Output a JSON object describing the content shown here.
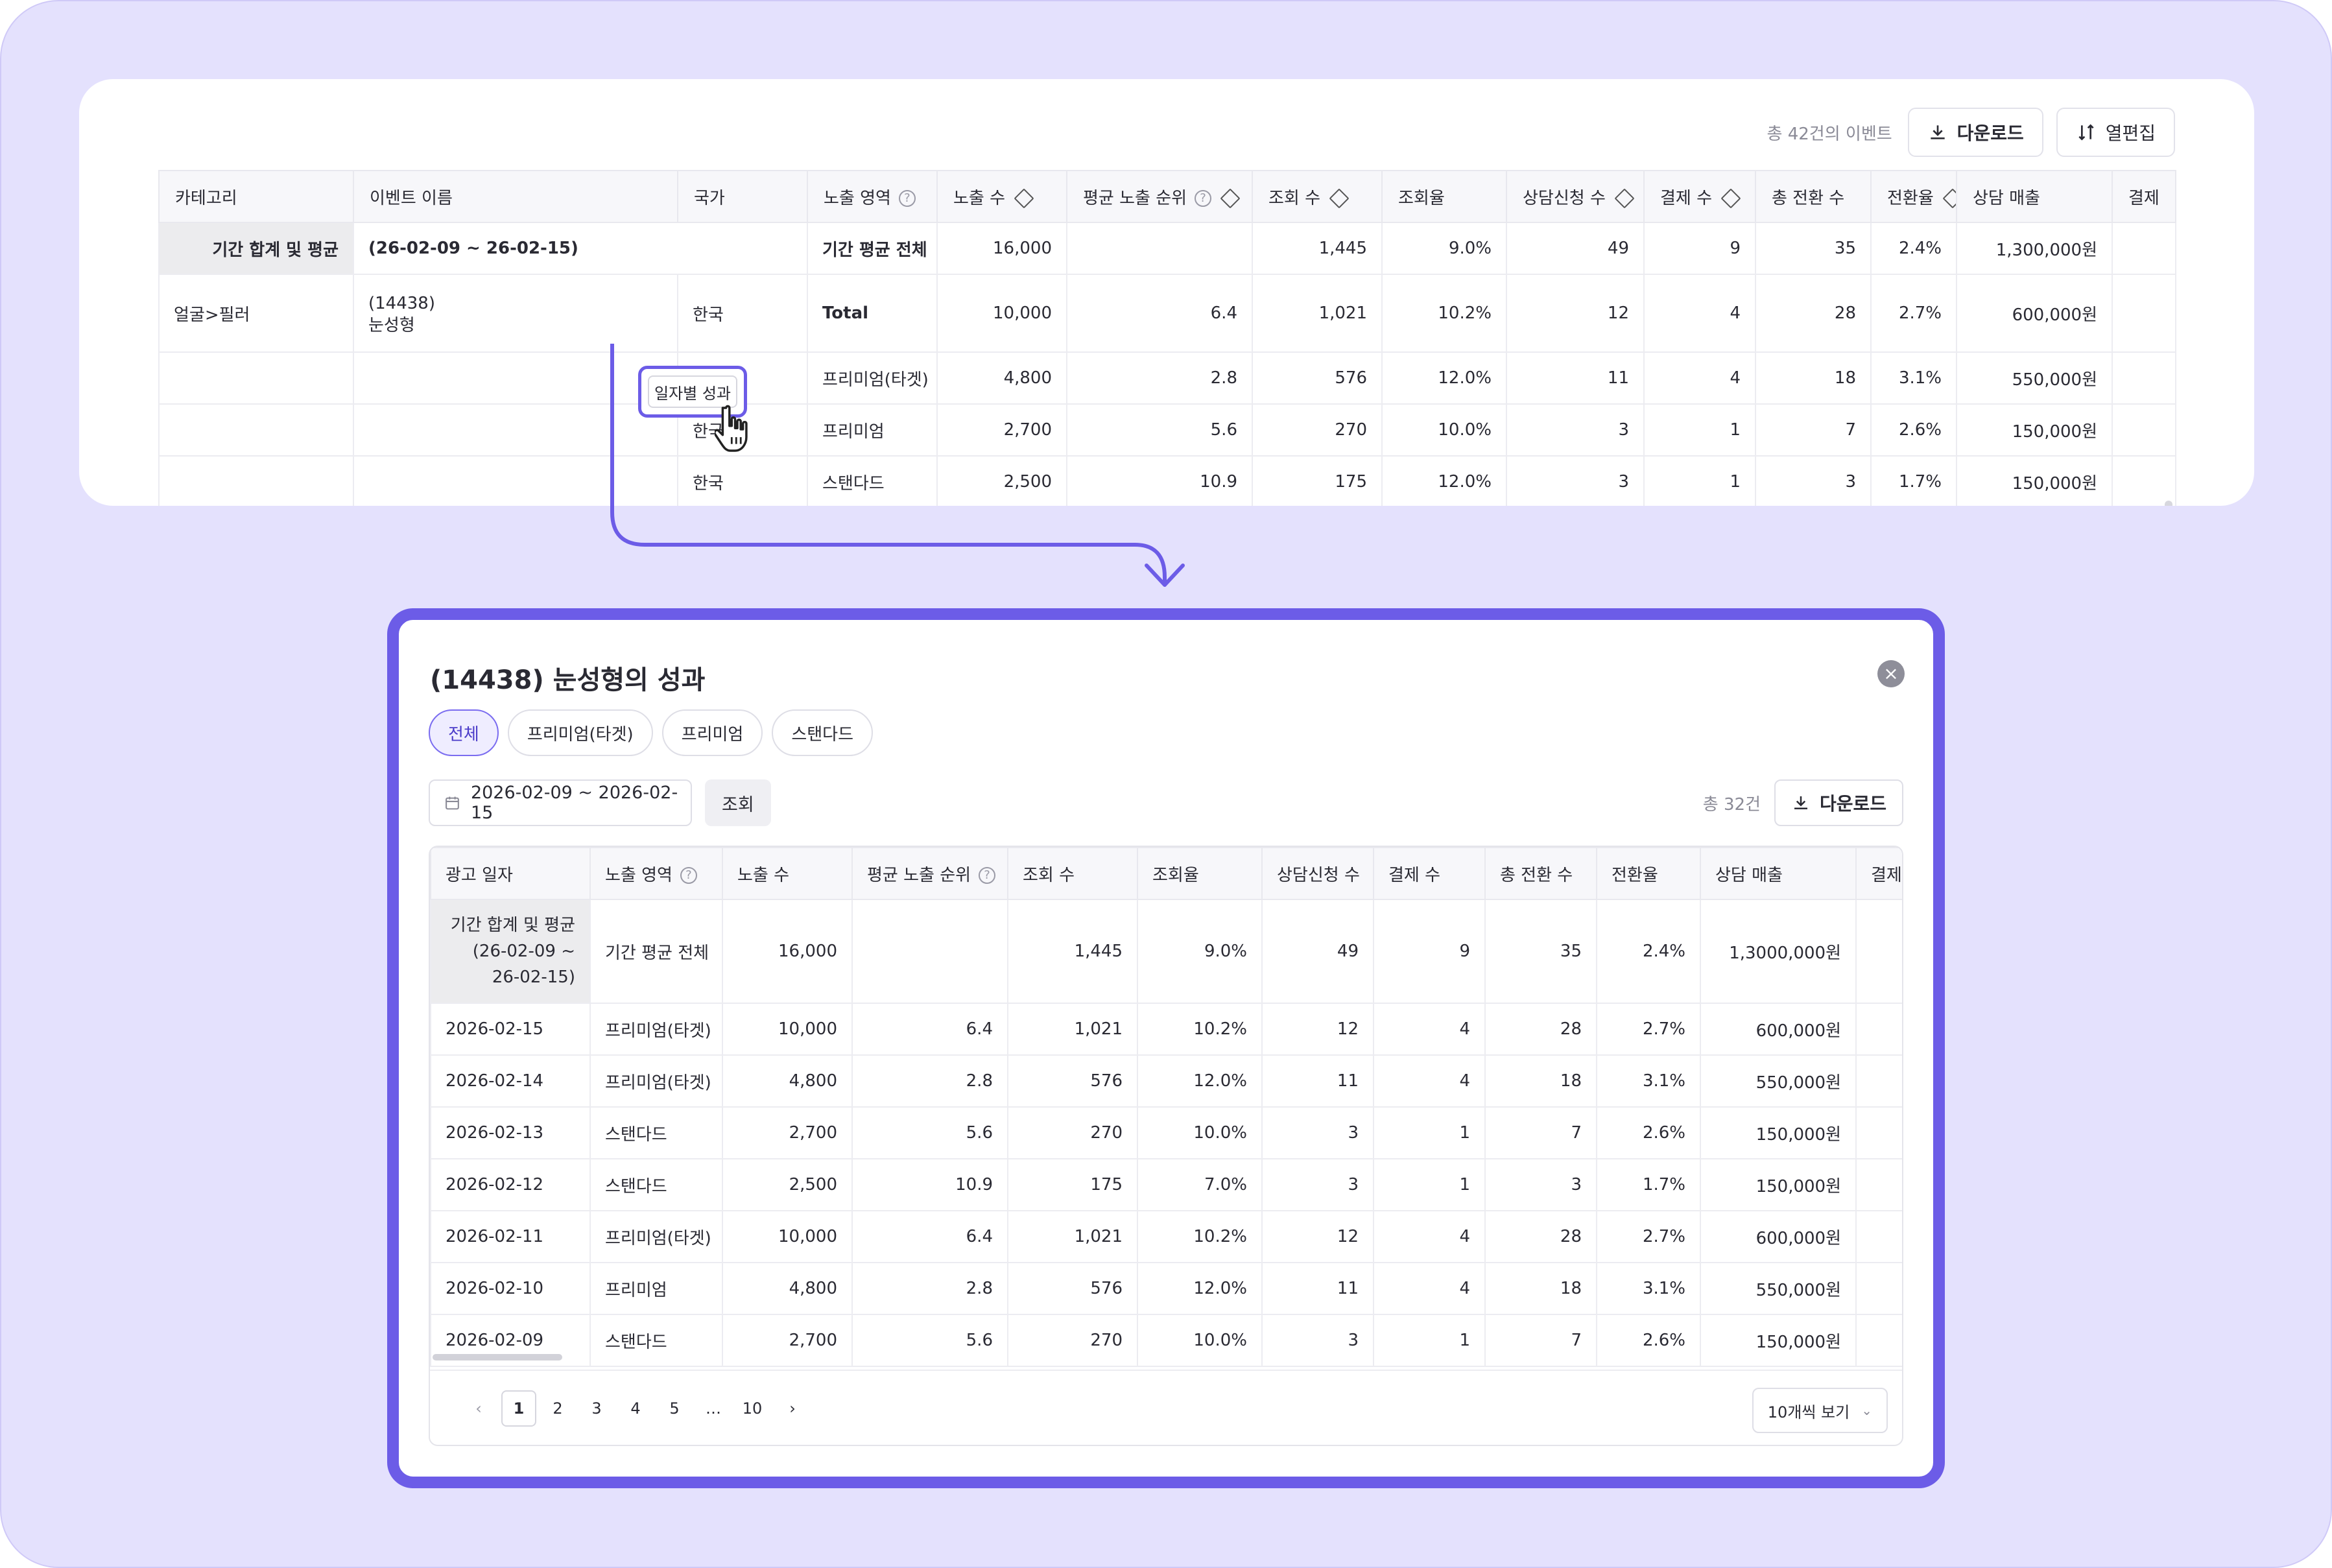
{
  "colors": {
    "accent": "#6c5ce7",
    "background": "#e4e1fd"
  },
  "top": {
    "count_text": "총 42건의 이벤트",
    "download_label": "다운로드",
    "columns_label": "열편집",
    "headers": [
      "카테고리",
      "이벤트 이름",
      "국가",
      "노출 영역",
      "노출 수",
      "평균 노출 순위",
      "조회 수",
      "조회율",
      "상담신청 수",
      "결제 수",
      "총 전환 수",
      "전환율",
      "상담 매출",
      "결제"
    ],
    "summary": {
      "label": "기간 합계 및 평균",
      "range": "(26-02-09 ~ 26-02-15)",
      "area": "기간 평균 전체",
      "impressions": "16,000",
      "rank": "",
      "views": "1,445",
      "view_rate": "9.0%",
      "consults": "49",
      "payments": "9",
      "conversions": "35",
      "conv_rate": "2.4%",
      "revenue": "1,300,000원"
    },
    "event": {
      "category": "얼굴>필러",
      "id": "(14438)",
      "name": "눈성형",
      "daily_button": "일자별 성과"
    },
    "rows": [
      {
        "country": "한국",
        "area": "Total",
        "impressions": "10,000",
        "rank": "6.4",
        "views": "1,021",
        "view_rate": "10.2%",
        "consults": "12",
        "payments": "4",
        "conversions": "28",
        "conv_rate": "2.7%",
        "revenue": "600,000원"
      },
      {
        "country": "한국",
        "area": "프리미엄(타겟)",
        "impressions": "4,800",
        "rank": "2.8",
        "views": "576",
        "view_rate": "12.0%",
        "consults": "11",
        "payments": "4",
        "conversions": "18",
        "conv_rate": "3.1%",
        "revenue": "550,000원"
      },
      {
        "country": "한국",
        "area": "프리미엄",
        "impressions": "2,700",
        "rank": "5.6",
        "views": "270",
        "view_rate": "10.0%",
        "consults": "3",
        "payments": "1",
        "conversions": "7",
        "conv_rate": "2.6%",
        "revenue": "150,000원"
      },
      {
        "country": "한국",
        "area": "스탠다드",
        "impressions": "2,500",
        "rank": "10.9",
        "views": "175",
        "view_rate": "12.0%",
        "consults": "3",
        "payments": "1",
        "conversions": "3",
        "conv_rate": "1.7%",
        "revenue": "150,000원"
      }
    ]
  },
  "modal": {
    "title": "(14438) 눈성형의 성과",
    "tabs": [
      "전체",
      "프리미엄(타겟)",
      "프리미엄",
      "스탠다드"
    ],
    "active_tab": "전체",
    "date_range": "2026-02-09 ~ 2026-02-15",
    "query_label": "조회",
    "count_text": "총 32건",
    "download_label": "다운로드",
    "headers": [
      "광고 일자",
      "노출 영역",
      "노출 수",
      "평균 노출 순위",
      "조회 수",
      "조회율",
      "상담신청 수",
      "결제 수",
      "총 전환 수",
      "전환율",
      "상담 매출",
      "결제"
    ],
    "summary": {
      "label": "기간 합계 및 평균 (26-02-09 ~ 26-02-15)",
      "area": "기간 평균 전체",
      "impressions": "16,000",
      "rank": "",
      "views": "1,445",
      "view_rate": "9.0%",
      "consults": "49",
      "payments": "9",
      "conversions": "35",
      "conv_rate": "2.4%",
      "revenue": "1,3000,000원"
    },
    "rows": [
      {
        "date": "2026-02-15",
        "area": "프리미엄(타겟)",
        "impressions": "10,000",
        "rank": "6.4",
        "views": "1,021",
        "view_rate": "10.2%",
        "consults": "12",
        "payments": "4",
        "conversions": "28",
        "conv_rate": "2.7%",
        "revenue": "600,000원"
      },
      {
        "date": "2026-02-14",
        "area": "프리미엄(타겟)",
        "impressions": "4,800",
        "rank": "2.8",
        "views": "576",
        "view_rate": "12.0%",
        "consults": "11",
        "payments": "4",
        "conversions": "18",
        "conv_rate": "3.1%",
        "revenue": "550,000원"
      },
      {
        "date": "2026-02-13",
        "area": "스탠다드",
        "impressions": "2,700",
        "rank": "5.6",
        "views": "270",
        "view_rate": "10.0%",
        "consults": "3",
        "payments": "1",
        "conversions": "7",
        "conv_rate": "2.6%",
        "revenue": "150,000원"
      },
      {
        "date": "2026-02-12",
        "area": "스탠다드",
        "impressions": "2,500",
        "rank": "10.9",
        "views": "175",
        "view_rate": "7.0%",
        "consults": "3",
        "payments": "1",
        "conversions": "3",
        "conv_rate": "1.7%",
        "revenue": "150,000원"
      },
      {
        "date": "2026-02-11",
        "area": "프리미엄(타겟)",
        "impressions": "10,000",
        "rank": "6.4",
        "views": "1,021",
        "view_rate": "10.2%",
        "consults": "12",
        "payments": "4",
        "conversions": "28",
        "conv_rate": "2.7%",
        "revenue": "600,000원"
      },
      {
        "date": "2026-02-10",
        "area": "프리미엄",
        "impressions": "4,800",
        "rank": "2.8",
        "views": "576",
        "view_rate": "12.0%",
        "consults": "11",
        "payments": "4",
        "conversions": "18",
        "conv_rate": "3.1%",
        "revenue": "550,000원"
      },
      {
        "date": "2026-02-09",
        "area": "스탠다드",
        "impressions": "2,700",
        "rank": "5.6",
        "views": "270",
        "view_rate": "10.0%",
        "consults": "3",
        "payments": "1",
        "conversions": "7",
        "conv_rate": "2.6%",
        "revenue": "150,000원"
      }
    ],
    "pagination": {
      "pages": [
        "1",
        "2",
        "3",
        "4",
        "5",
        "…",
        "10"
      ],
      "current": "1",
      "page_size": "10개씩 보기"
    }
  }
}
